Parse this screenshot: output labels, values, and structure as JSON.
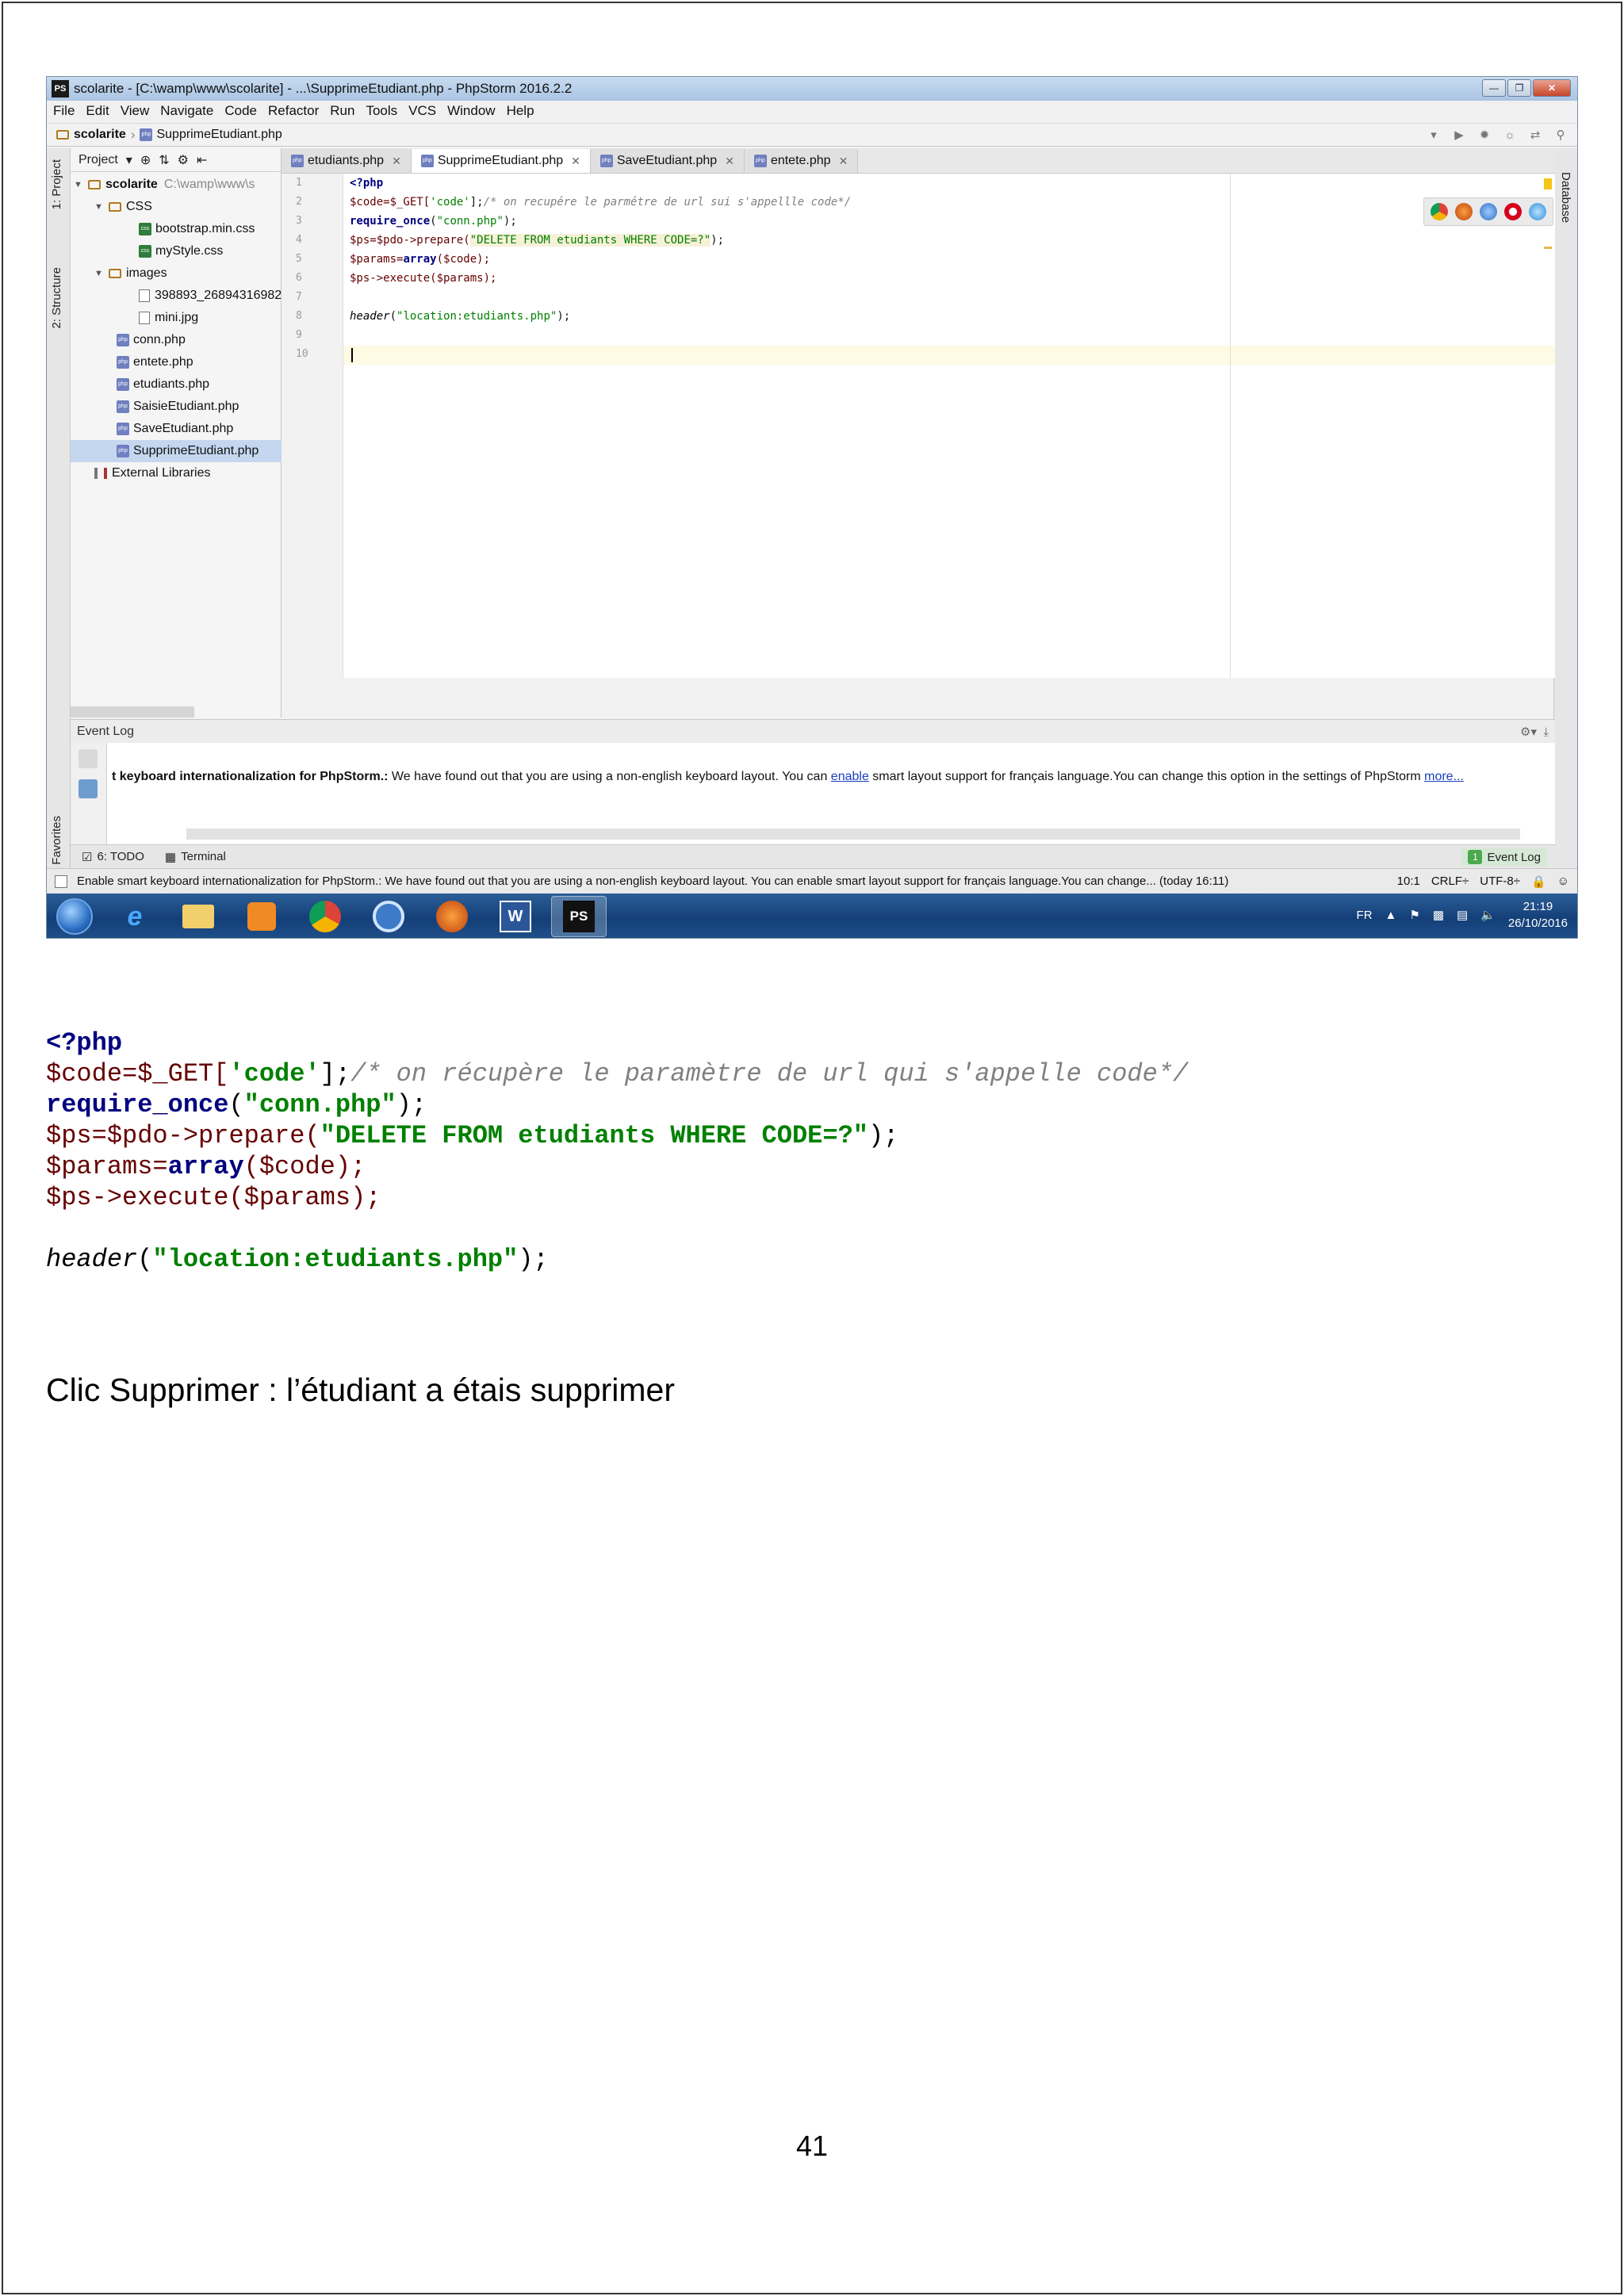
{
  "ide": {
    "window_title": "scolarite - [C:\\wamp\\www\\scolarite] - ...\\SupprimeEtudiant.php - PhpStorm 2016.2.2",
    "menu": [
      "File",
      "Edit",
      "View",
      "Navigate",
      "Code",
      "Refactor",
      "Run",
      "Tools",
      "VCS",
      "Window",
      "Help"
    ],
    "breadcrumb": [
      "scolarite",
      "SupprimeEtudiant.php"
    ],
    "side_tabs_left": [
      "1: Project",
      "2: Structure",
      "2: Favorites"
    ],
    "side_tab_right": "Database",
    "project_panel": {
      "header": "Project",
      "root": "scolarite",
      "root_path": "C:\\wamp\\www\\s",
      "folders": {
        "css": "CSS",
        "images": "images"
      },
      "files": {
        "bootstrap": "bootstrap.min.css",
        "mystyle": "myStyle.css",
        "img1": "398893_26894316982",
        "img2": "mini.jpg",
        "conn": "conn.php",
        "entete": "entete.php",
        "etudiants": "etudiants.php",
        "saisie": "SaisieEtudiant.php",
        "save": "SaveEtudiant.php",
        "supprime": "SupprimeEtudiant.php"
      },
      "external": "External Libraries"
    },
    "tabs": [
      {
        "label": "etudiants.php",
        "active": false
      },
      {
        "label": "SupprimeEtudiant.php",
        "active": true
      },
      {
        "label": "SaveEtudiant.php",
        "active": false
      },
      {
        "label": "entete.php",
        "active": false
      }
    ],
    "line_numbers": [
      "1",
      "2",
      "3",
      "4",
      "5",
      "6",
      "7",
      "8",
      "9",
      "10"
    ],
    "code": {
      "l1": "<?php",
      "l2a": "$code=$_GET[",
      "l2b": "'code'",
      "l2c": "];",
      "l2d": "/* on recupére le parmétre de url sui s'appellle code*/",
      "l3a": "require_once",
      "l3b": "(",
      "l3c": "\"conn.php\"",
      "l3d": ");",
      "l4a": "$ps=$pdo->prepare(",
      "l4b": "\"DELETE FROM etudiants WHERE CODE=?\"",
      "l4c": ");",
      "l5a": "$params=",
      "l5b": "array",
      "l5c": "($code);",
      "l6": "$ps->execute($params);",
      "l8a": "header",
      "l8b": "(",
      "l8c": "\"location:etudiants.php\"",
      "l8d": ");"
    },
    "event_log": {
      "title": "Event Log",
      "msg_bold": "t keyboard internationalization for PhpStorm.:",
      "msg_text": " We have found out that you are using a non-english keyboard layout. You can ",
      "msg_link": "enable",
      "msg_text2": " smart layout support for français language.You can change this option in the settings of PhpStorm ",
      "msg_more": "more..."
    },
    "toolwindows": {
      "todo": "6: TODO",
      "terminal": "Terminal",
      "event_log_count": "1",
      "event_log": "Event Log"
    },
    "status": {
      "message": "Enable smart keyboard internationalization for PhpStorm.: We have found out that you are using a non-english keyboard layout. You can enable smart layout support for français language.You can change... (today 16:11)",
      "position": "10:1",
      "line_sep": "CRLF÷",
      "encoding": "UTF-8÷"
    },
    "taskbar": {
      "lang": "FR",
      "time": "21:19",
      "date": "26/10/2016",
      "word_label": "W",
      "ps_label": "PS"
    }
  },
  "snippet": {
    "l1": "<?php",
    "l2a": "$code=$_GET[",
    "l2b": "'code'",
    "l2c": "];",
    "l2d": "/* on récupère le paramètre de url qui s'appelle code*/",
    "l3a": "require_once",
    "l3b": "(",
    "l3c": "\"conn.php\"",
    "l3d": ");",
    "l4a": "$ps=$pdo->prepare(",
    "l4b": "\"DELETE FROM etudiants WHERE CODE=?\"",
    "l4c": ");",
    "l5a": "$params=",
    "l5b": "array",
    "l5c": "($code);",
    "l6": "$ps->execute($params);",
    "l8a": "header",
    "l8b": "(",
    "l8c": "\"location:etudiants.php\"",
    "l8d": ");"
  },
  "caption": "Clic Supprimer : l’étudiant a étais supprimer",
  "page_number": "41"
}
